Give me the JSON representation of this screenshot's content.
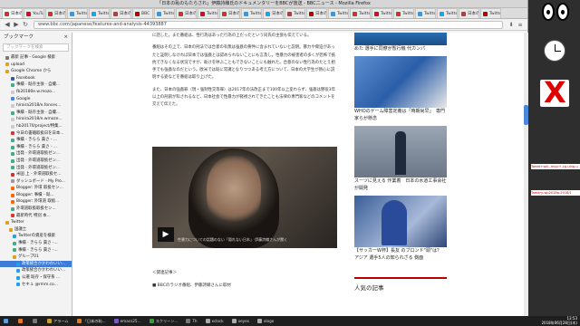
{
  "window": {
    "title": "「日本の恥のもたらされ」伊藤詩織氏のドキュメンタリーをBBCが放送 - BBCニュース - Mozilla Firefox"
  },
  "tabs": [
    "日本の恥",
    "YouTube",
    "日本の恥",
    "Twitter",
    "Twitter",
    "日本の恥",
    "BBC",
    "Twitter",
    "日本の恥",
    "Twitter",
    "日本の恥",
    "Twitter",
    "日本の恥",
    "Twitter",
    "日本の恥",
    "Twitter",
    "Twitter",
    "Twitter",
    "Twitter",
    "Twitter",
    "Twitter",
    "日本の恥",
    "Twitter"
  ],
  "url": "www.bbc.com/japanese/features-and-analysis-44393887",
  "sidebar": {
    "title": "ブックマーク",
    "close": "×",
    "search_placeholder": "ブックマークを検索",
    "items": [
      "最新 記事 - Google 検索",
      "upload",
      "Google Chrome から",
      "Facebook",
      "事績 - 既存主張 - 自撮...",
      "fb20180e.w.mozo...",
      "Google",
      "hiroira2018/e.fonces...",
      "事績 - 既存主張 - 自撮...",
      "hiroira2018/e.wmoze...",
      "hb20170/project/特集...",
      "今日の書籍取扱日を日本...",
      "事績 - きらら 貴さ - ...",
      "事績 - きらら 貴さ - ...",
      "出発 - 外環道取扱ゼン...",
      "出発 - 外環道取扱ゼン...",
      "出発 - 外環道取扱ゼン...",
      "米国 上 - 外環道取扱セ...",
      "ダッシュボード - My Pro...",
      "Blogger: 外環 取扱セン...",
      "Blogger: 事績 - 既...",
      "Blogger: 外環道 取扱...",
      "外環道取扱取扱セン...",
      "最新時代 特別 本...",
      "Twitter",
      "国議士",
      "Twitterの資産を検索",
      "事績 - きらら 貴さ -...",
      "事績 - きらら 貴さ -...",
      "グループ01",
      "政策統合かかわわいい...",
      "政策統合かかわわいい...",
      "公選 既存・保守系 ...",
      "セキュ @rmm.co..."
    ]
  },
  "article": {
    "para1": "に話した。また番組は、性行為はあった行為の上だったという同氏の主張も伝えている。",
    "para2": "番組はその上で、日本の刑法では合意の有無は強姦の要件に含まれていないと説明。暴力や脅迫があったと証明しなければ日本では強姦とは認められないことにも言及し。性暴力の被害者の多くが恐怖で抵抗できなくなる状況ですが、助けを呼ぶこともできないことにも触れた。合意のない性行為のたとえ相手でも強姦なのだという。欧米では既に常識となりつつある考え方について、日本の大学生が熱心に説明する姿などを番組は取り上げた。",
    "para3": "また、日本の強姦罪（現・強制性交等罪）は2017年の法改正まで100年以上変わらず、強姦は懲役3年以上の刑罰が科されるなど、日本社会で性暴力が軽視されてきたことも法律の専門家などのコメントを交えて伝えた。",
    "video_caption": "性暴力についての話題のない「隠れない日本」 伊藤詩織さんが聞く",
    "related_heading": "＜関連記事＞",
    "related_item": "■ BBCのラジオ番組、伊藤詩織さんに取材"
  },
  "rightcol": {
    "top_text": "めた 選手に同僚が暫行機 代カンパ",
    "item1": "WHOのゲーム障害定義は「時期尚早」　専門家らが懸念",
    "item2": "スーツに見える 作業着　日本の水道工事会社が開発",
    "item3": "【サッカーW杯】長友 のブロンド\"頭\"は？　アジア 選手5人の知られざる 側面",
    "popular_heading": "人気の記事"
  },
  "desktop": {
    "note1": "Tweet+will.-myyi+-cg-uing.u",
    "note2": "Tamary-wp2018p-2018/1"
  },
  "taskbar": {
    "items": [
      "アラーム",
      "「日本の恥...",
      "emacs25...",
      "スクリーン...",
      "Th",
      "xclock",
      "xeyes",
      "xlogo"
    ],
    "time": "13:53",
    "date": "2018年06月28日(木)"
  },
  "colors": {
    "accent": "#b80000",
    "selection": "#3d7bd6"
  }
}
